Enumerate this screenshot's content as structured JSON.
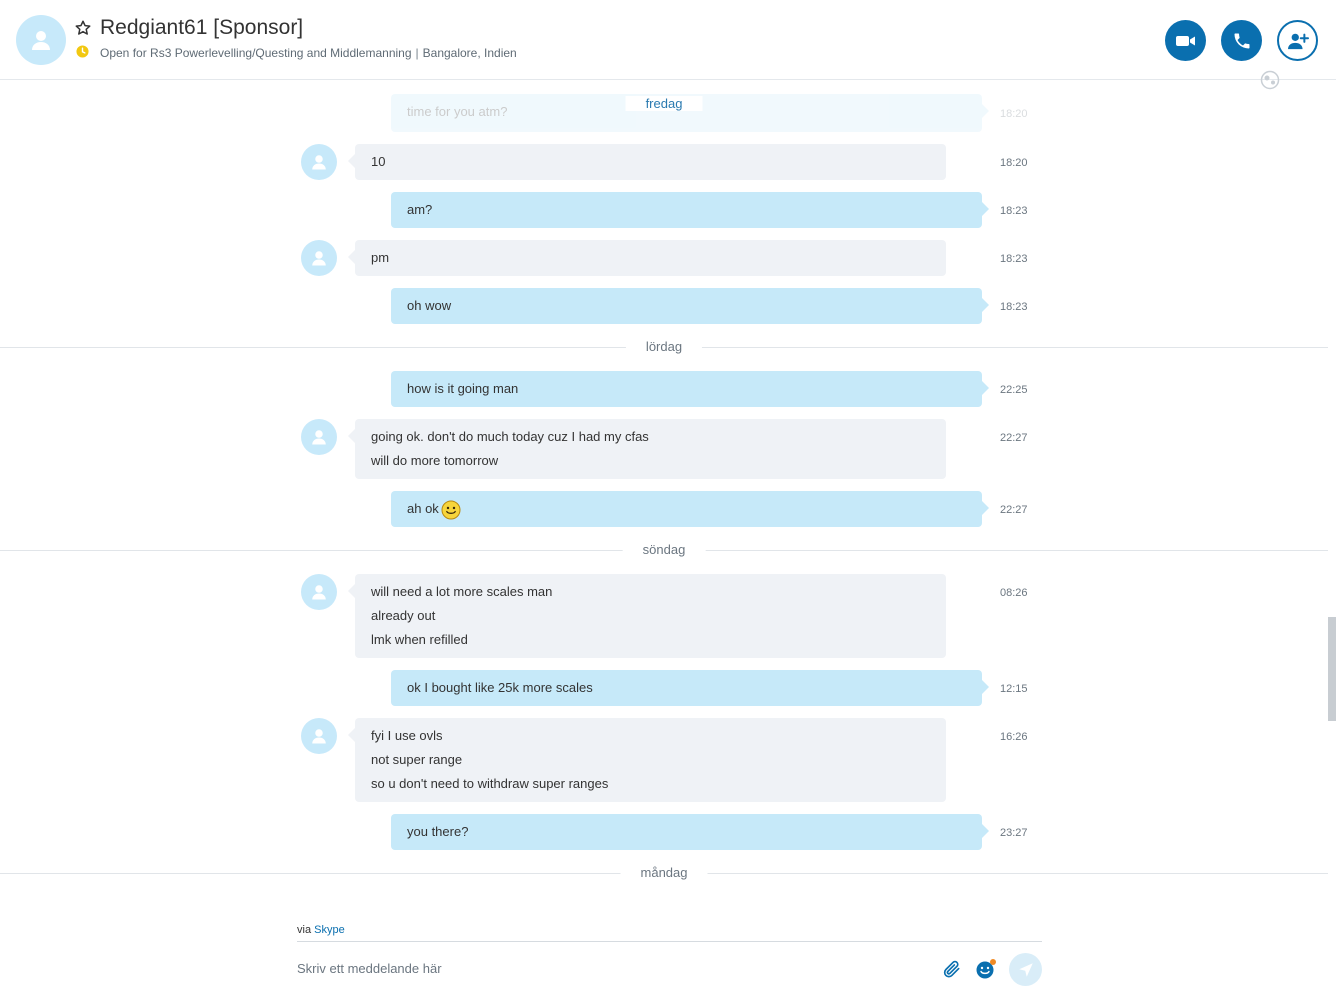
{
  "header": {
    "title": "Redgiant61 [Sponsor]",
    "mood": "Open for Rs3 Powerlevelling/Questing and Middlemanning",
    "separator": "|",
    "location": "Bangalore, Indien",
    "icons": [
      "avatar-icon",
      "star-icon",
      "away-clock-icon",
      "video-call-icon",
      "voice-call-icon",
      "add-contact-icon",
      "globe-icon"
    ],
    "accent_color": "#0a6faf",
    "status_color": "#f2c811"
  },
  "chat": {
    "partial_message": {
      "text": "time for you atm?",
      "time": "18:20"
    },
    "days": [
      {
        "label": "fredag",
        "messages": [
          {
            "dir": "in",
            "lines": [
              "10"
            ],
            "time": "18:20"
          },
          {
            "dir": "out",
            "lines": [
              "am?"
            ],
            "time": "18:23"
          },
          {
            "dir": "in",
            "lines": [
              "pm"
            ],
            "time": "18:23"
          },
          {
            "dir": "out",
            "lines": [
              "oh wow"
            ],
            "time": "18:23"
          }
        ]
      },
      {
        "label": "lördag",
        "messages": [
          {
            "dir": "out",
            "lines": [
              "how is it going man"
            ],
            "time": "22:25"
          },
          {
            "dir": "in",
            "lines": [
              "going ok. don't do much today cuz I had my cfas",
              "will do more tomorrow"
            ],
            "time": "22:27"
          },
          {
            "dir": "out",
            "lines": [
              "ah ok"
            ],
            "emoticon": "smiley-icon",
            "time": "22:27"
          }
        ]
      },
      {
        "label": "söndag",
        "messages": [
          {
            "dir": "in",
            "lines": [
              "will need a lot more scales man",
              "already out",
              "lmk when refilled"
            ],
            "time": "08:26"
          },
          {
            "dir": "out",
            "lines": [
              "ok I bought like 25k more scales"
            ],
            "time": "12:15"
          },
          {
            "dir": "in",
            "lines": [
              "fyi I use ovls",
              "not super range",
              "so u don't need to withdraw super ranges"
            ],
            "time": "16:26"
          },
          {
            "dir": "out",
            "lines": [
              "you there?"
            ],
            "time": "23:27"
          }
        ]
      },
      {
        "label": "måndag",
        "messages": []
      }
    ]
  },
  "compose": {
    "via_prefix": "via",
    "via_service": "Skype",
    "placeholder": "Skriv ett meddelande här",
    "icons": [
      "attach-icon",
      "emoticon-icon",
      "send-icon"
    ]
  }
}
